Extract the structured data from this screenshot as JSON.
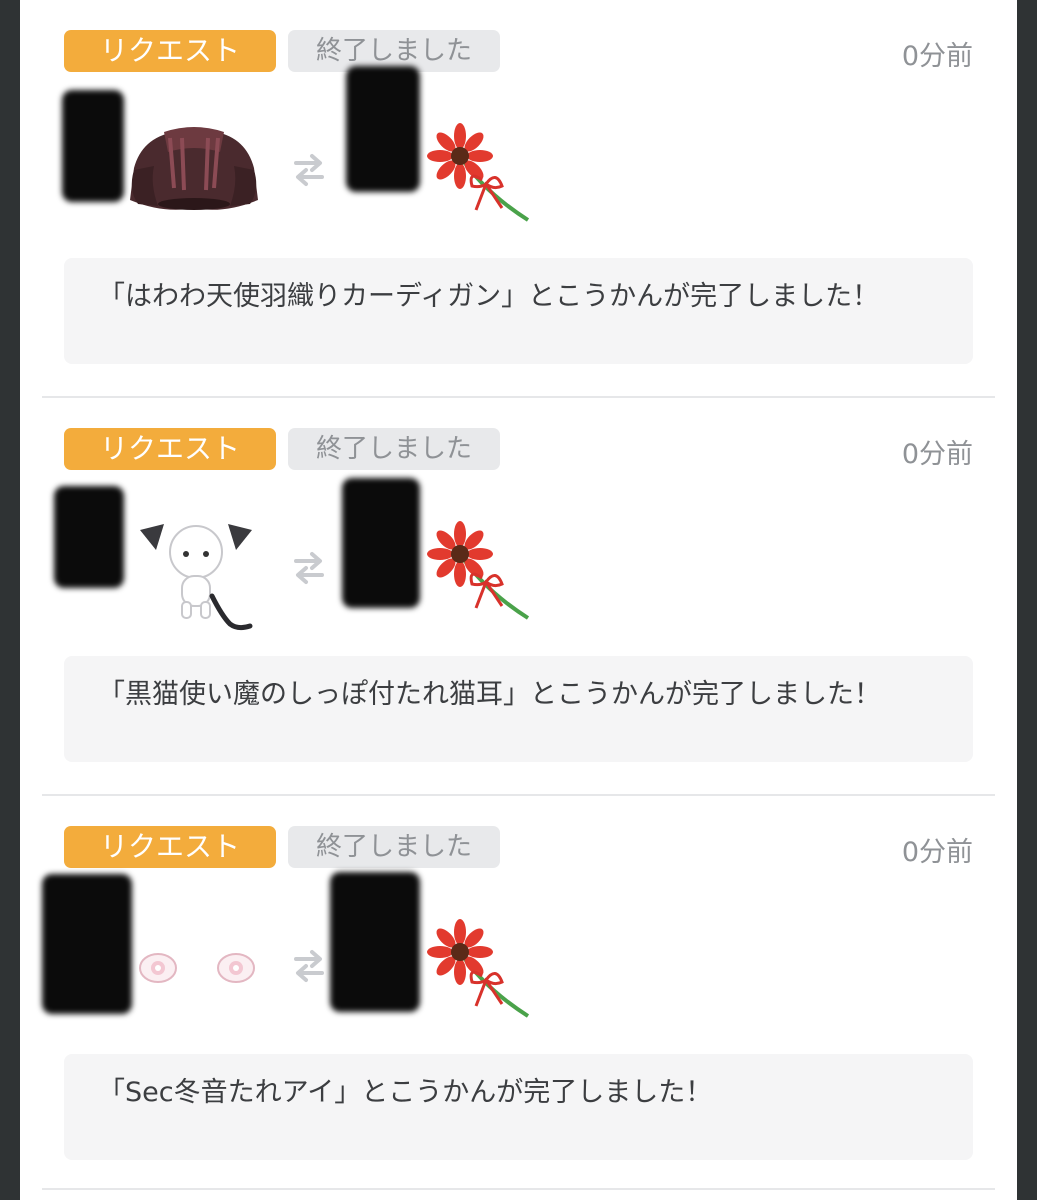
{
  "trades": [
    {
      "request_label": "リクエスト",
      "status_label": "終了しました",
      "time": "0分前",
      "given_item_icon": "cardigan-icon",
      "received_item_icon": "red-flower-icon",
      "message": "「はわわ天使羽織りカーディガン」とこうかんが完了しました！"
    },
    {
      "request_label": "リクエスト",
      "status_label": "終了しました",
      "time": "0分前",
      "given_item_icon": "cat-ears-icon",
      "received_item_icon": "red-flower-icon",
      "message": "「黒猫使い魔のしっぽ付たれ猫耳」とこうかんが完了しました！"
    },
    {
      "request_label": "リクエスト",
      "status_label": "終了しました",
      "time": "0分前",
      "given_item_icon": "eyes-icon",
      "received_item_icon": "red-flower-icon",
      "message": "「Sec冬音たれアイ」とこうかんが完了しました！"
    }
  ],
  "colors": {
    "request_badge": "#f3ac3c",
    "status_badge": "#e8e9eb",
    "message_bg": "#f5f5f6"
  }
}
